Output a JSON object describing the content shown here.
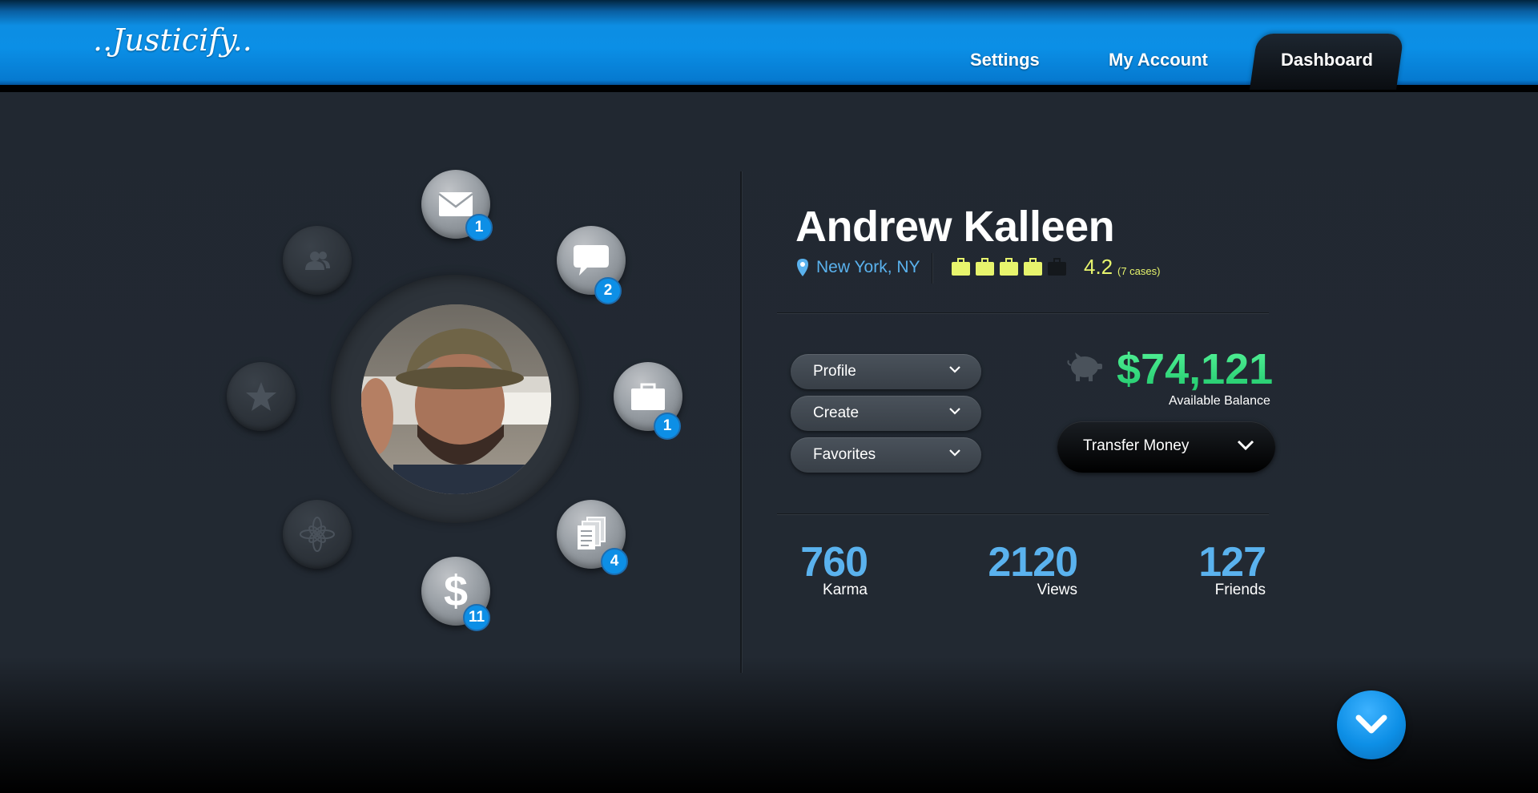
{
  "header": {
    "logo": "..Justicify..",
    "nav": {
      "settings": "Settings",
      "my_account": "My Account",
      "dashboard": "Dashboard"
    }
  },
  "menu": {
    "mail_count": "1",
    "chat_count": "2",
    "cases_count": "1",
    "documents_count": "4",
    "payments_count": "11"
  },
  "profile": {
    "name": "Andrew Kalleen",
    "location": "New York, NY",
    "case_rating_icons": [
      true,
      true,
      true,
      true,
      false
    ],
    "rating": "4.2",
    "rating_sub": "(7 cases)"
  },
  "dropdowns": [
    {
      "label": "Profile"
    },
    {
      "label": "Create"
    },
    {
      "label": "Favorites"
    }
  ],
  "balance": {
    "amount": "$74,121",
    "label": "Available Balance",
    "transfer_label": "Transfer Money"
  },
  "stats": [
    {
      "value": "760",
      "label": "Karma"
    },
    {
      "value": "2120",
      "label": "Views"
    },
    {
      "value": "127",
      "label": "Friends"
    }
  ],
  "colors": {
    "accent_blue": "#0d8fe6",
    "balance_green": "#3fe08a",
    "rating_yellow": "#e7f46d",
    "stat_blue": "#5ab2ee"
  }
}
